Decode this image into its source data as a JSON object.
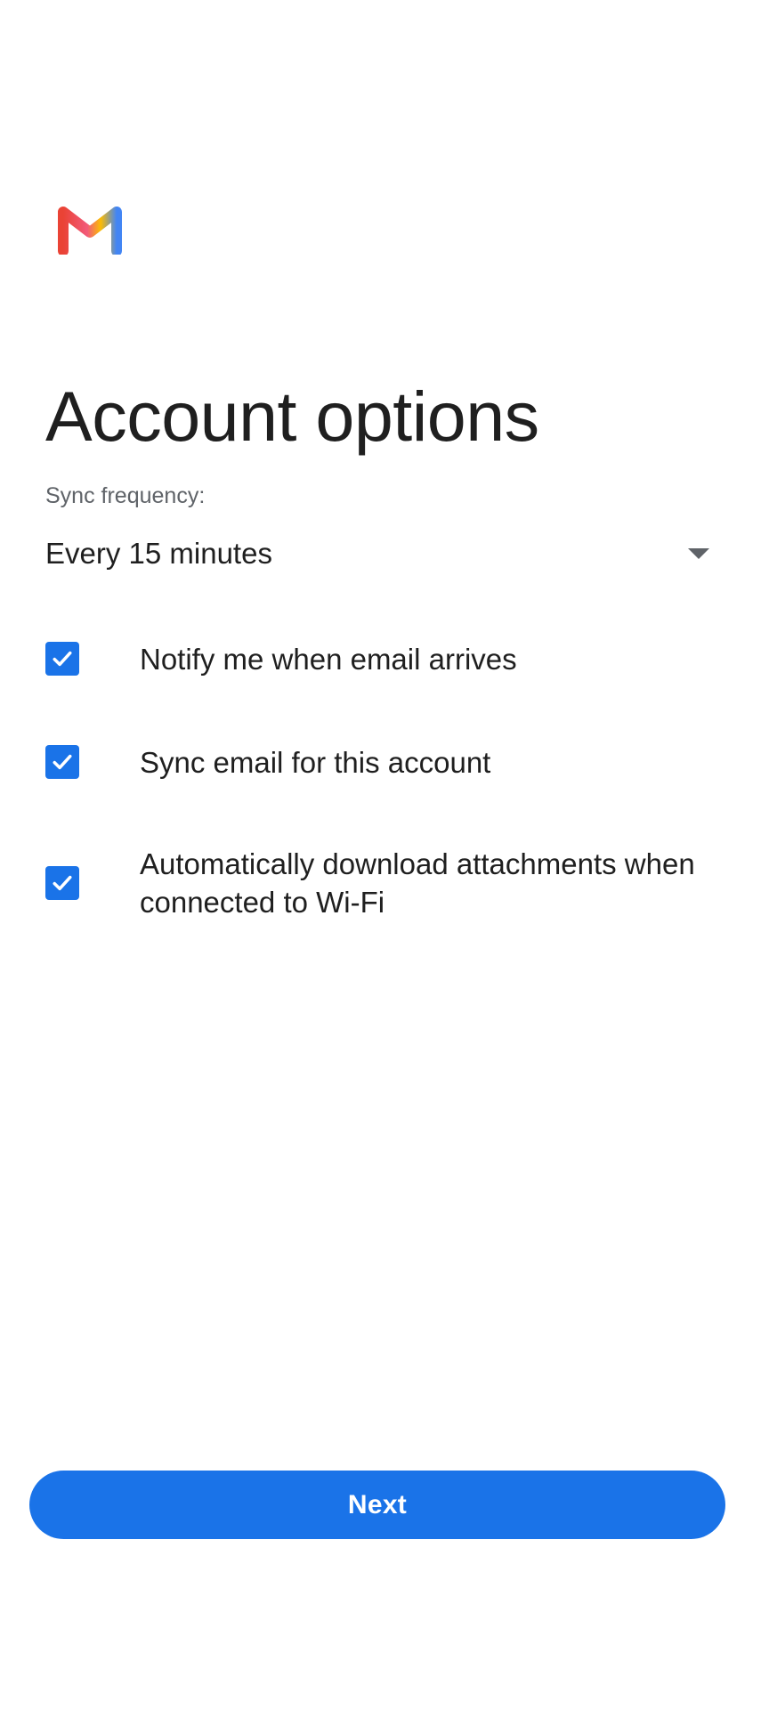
{
  "header": {
    "logo_icon": "gmail-logo-icon",
    "title": "Account options"
  },
  "sync": {
    "label": "Sync frequency:",
    "selected_value": "Every 15 minutes",
    "icon": "dropdown-arrow-icon"
  },
  "options": [
    {
      "label": "Notify me when email arrives",
      "checked": true
    },
    {
      "label": "Sync email for this account",
      "checked": true
    },
    {
      "label": "Automatically download attachments when connected to Wi-Fi",
      "checked": true
    }
  ],
  "footer": {
    "next_label": "Next"
  },
  "colors": {
    "accent": "#1a73e8",
    "text_primary": "#1f1f1f",
    "text_secondary": "#5f6368",
    "background": "#ffffff"
  }
}
